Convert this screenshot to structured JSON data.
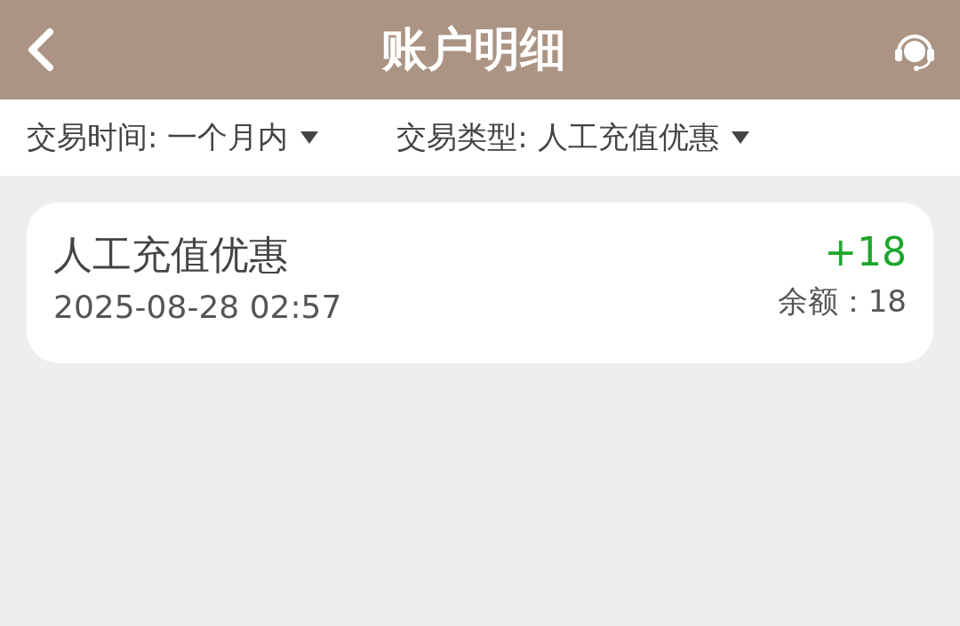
{
  "header": {
    "title": "账户明细"
  },
  "filters": [
    {
      "label": "交易时间: 一个月内"
    },
    {
      "label": "交易类型: 人工充值优惠"
    }
  ],
  "transactions": [
    {
      "type": "人工充值优惠",
      "time": "2025-08-28 02:57",
      "amount": "+18",
      "balance": "余额：18"
    }
  ]
}
